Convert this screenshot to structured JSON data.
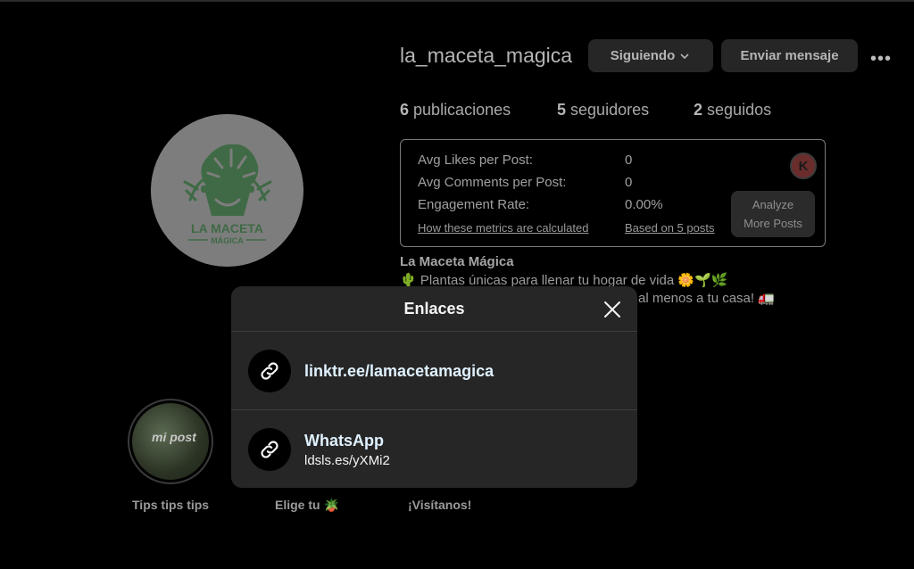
{
  "profile": {
    "username": "la_maceta_magica",
    "follow_button": "Siguiendo",
    "message_button": "Enviar mensaje",
    "more_label": "•••",
    "avatar": {
      "line1": "LA MACETA",
      "line2": "MÁGICA"
    }
  },
  "stats": [
    {
      "count": "6",
      "label": "publicaciones"
    },
    {
      "count": "5",
      "label": "seguidores"
    },
    {
      "count": "2",
      "label": "seguidos"
    }
  ],
  "metrics": {
    "rows": [
      {
        "label": "Avg Likes per Post:",
        "value": "0"
      },
      {
        "label": "Avg Comments per Post:",
        "value": "0"
      },
      {
        "label": "Engagement Rate:",
        "value": "0.00%"
      }
    ],
    "how_link": "How these metrics are calculated",
    "based_link": "Based on 5 posts",
    "badge": "K",
    "analyze_line1": "Analyze",
    "analyze_line2": "More Posts"
  },
  "bio": {
    "name": "La Maceta Mágica",
    "line1": "🌵 Plantas únicas para llenar tu hogar de vida 🌼🌱🌿",
    "line2": "al menos a tu casa! 🚛"
  },
  "highlights": [
    {
      "label": "Tips tips tips",
      "cover_text": "mi post"
    },
    {
      "label": "Elige tu 🪴"
    },
    {
      "label": "¡Visítanos!"
    }
  ],
  "modal": {
    "title": "Enlaces",
    "links": [
      {
        "title": "linktr.ee/lamacetamagica",
        "subtitle": ""
      },
      {
        "title": "WhatsApp",
        "subtitle": "ldsls.es/yXMi2"
      }
    ]
  },
  "colors": {
    "background": "#000000",
    "modal": "#262626",
    "link_text": "#e0f1ff",
    "logo_green": "#3f6a45"
  }
}
